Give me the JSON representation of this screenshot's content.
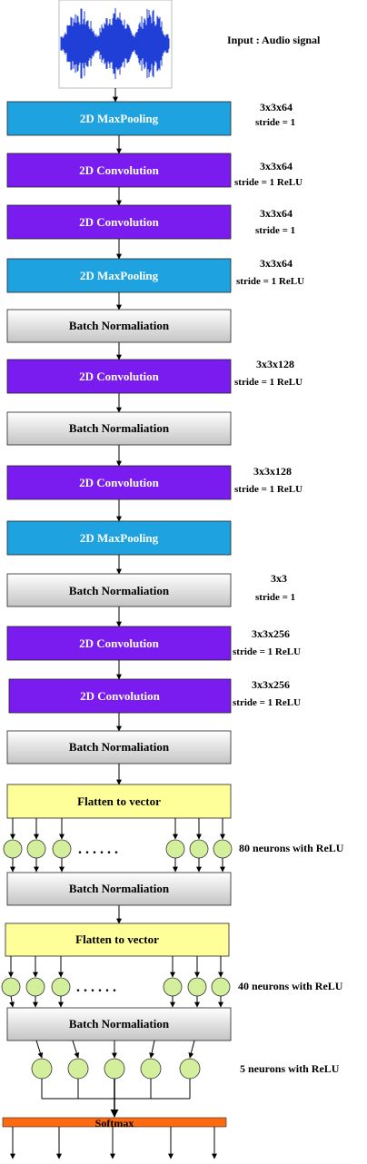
{
  "input": {
    "label": "Input : Audio signal"
  },
  "layers": [
    {
      "label": "2D MaxPooling",
      "kind": "maxpool",
      "spec1": "3x3x64",
      "spec2": "stride = 1"
    },
    {
      "label": "2D Convolution",
      "kind": "conv",
      "spec1": "3x3x64",
      "spec2": "stride = 1  ReLU"
    },
    {
      "label": "2D Convolution",
      "kind": "conv",
      "spec1": "3x3x64",
      "spec2": "stride = 1"
    },
    {
      "label": "2D MaxPooling",
      "kind": "maxpool",
      "spec1": "3x3x64",
      "spec2": "stride = 1  ReLU"
    },
    {
      "label": "Batch Normaliation",
      "kind": "batchnorm",
      "spec1": "",
      "spec2": ""
    },
    {
      "label": "2D Convolution",
      "kind": "conv",
      "spec1": "3x3x128",
      "spec2": "stride = 1  ReLU"
    },
    {
      "label": "Batch Normaliation",
      "kind": "batchnorm",
      "spec1": "",
      "spec2": ""
    },
    {
      "label": "2D Convolution",
      "kind": "conv",
      "spec1": "3x3x128",
      "spec2": "stride = 1  ReLU"
    },
    {
      "label": "2D MaxPooling",
      "kind": "maxpool",
      "spec1": "",
      "spec2": ""
    },
    {
      "label": "Batch Normaliation",
      "kind": "batchnorm",
      "spec1": "3x3",
      "spec2": "stride = 1"
    },
    {
      "label": "2D Convolution",
      "kind": "conv",
      "spec1": "3x3x256",
      "spec2": "stride = 1  ReLU"
    },
    {
      "label": "2D Convolution",
      "kind": "conv",
      "spec1": "3x3x256",
      "spec2": "stride = 1  ReLU"
    },
    {
      "label": "Batch Normaliation",
      "kind": "batchnorm",
      "spec1": "",
      "spec2": ""
    },
    {
      "label": "Flatten to vector",
      "kind": "flatten",
      "spec1": "",
      "spec2": ""
    }
  ],
  "dense_blocks": [
    {
      "neurons_label": "80 neurons with ReLU",
      "next_label": "Batch Normaliation",
      "next_kind": "batchnorm"
    },
    {
      "neurons_label": "Flatten to vector",
      "next_label": "Flatten to vector",
      "next_kind": "flatten"
    },
    {
      "neurons_label": "40 neurons with ReLU",
      "next_label": "Batch Normaliation",
      "next_kind": "batchnorm"
    }
  ],
  "neurons_80": "80 neurons with ReLU",
  "neurons_40": "40 neurons with ReLU",
  "neurons_5": "5 neurons with ReLU",
  "bn_a": "Batch Normaliation",
  "flatten_b": "Flatten to vector",
  "bn_b": "Batch Normaliation",
  "softmax": "Softmax",
  "dots": ". . . . . .",
  "colors": {
    "maxpool": "#1fa3e0",
    "conv": "#7a1cf0",
    "batchnorm_top": "#ffffff",
    "batchnorm_bottom": "#c4c4c4",
    "flatten": "#ffff99",
    "neuron": "#d4ef9c",
    "softmax": "#ff6a10",
    "waveform": "#1f3fd6"
  }
}
